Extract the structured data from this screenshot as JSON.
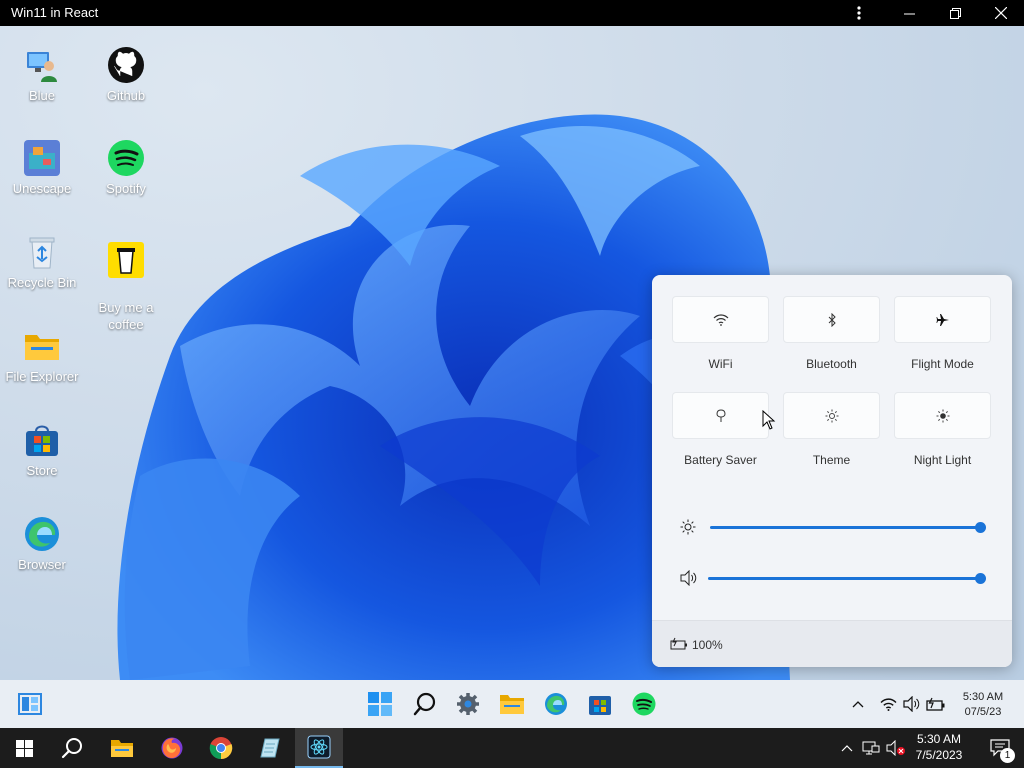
{
  "window": {
    "title": "Win11 in React"
  },
  "desktop_icons": [
    {
      "label": "Blue",
      "icon": "user-pc-icon"
    },
    {
      "label": "Github",
      "icon": "github-icon"
    },
    {
      "label": "Unescape",
      "icon": "unescape-game-icon"
    },
    {
      "label": "Spotify",
      "icon": "spotify-icon"
    },
    {
      "label": "Recycle Bin",
      "icon": "recycle-bin-icon"
    },
    {
      "label": "Buy me a\ncoffee",
      "icon": "coffee-cup-icon"
    },
    {
      "label": "File Explorer",
      "icon": "folder-icon"
    },
    {
      "label": "Store",
      "icon": "store-icon"
    },
    {
      "label": "Browser",
      "icon": "edge-icon"
    }
  ],
  "quick_settings": {
    "toggles": [
      {
        "label": "WiFi",
        "icon": "wifi-icon"
      },
      {
        "label": "Bluetooth",
        "icon": "bluetooth-icon"
      },
      {
        "label": "Flight Mode",
        "icon": "airplane-icon"
      },
      {
        "label": "Battery Saver",
        "icon": "battery-saver-icon"
      },
      {
        "label": "Theme",
        "icon": "sun-icon"
      },
      {
        "label": "Night Light",
        "icon": "night-light-icon"
      }
    ],
    "brightness": 100,
    "volume": 100,
    "battery_label": "100%"
  },
  "app_taskbar": {
    "apps": [
      "start-icon",
      "search-icon",
      "settings-icon",
      "file-explorer-icon",
      "edge-icon",
      "store-icon",
      "spotify-icon"
    ],
    "time": "5:30 AM",
    "date": "07/5/23"
  },
  "host_taskbar": {
    "time": "5:30 AM",
    "date": "7/5/2023",
    "notification_count": "1"
  },
  "colors": {
    "accent": "#1a73d8",
    "taskbar": "#e9eef4",
    "host_taskbar": "#1c1c1c"
  }
}
